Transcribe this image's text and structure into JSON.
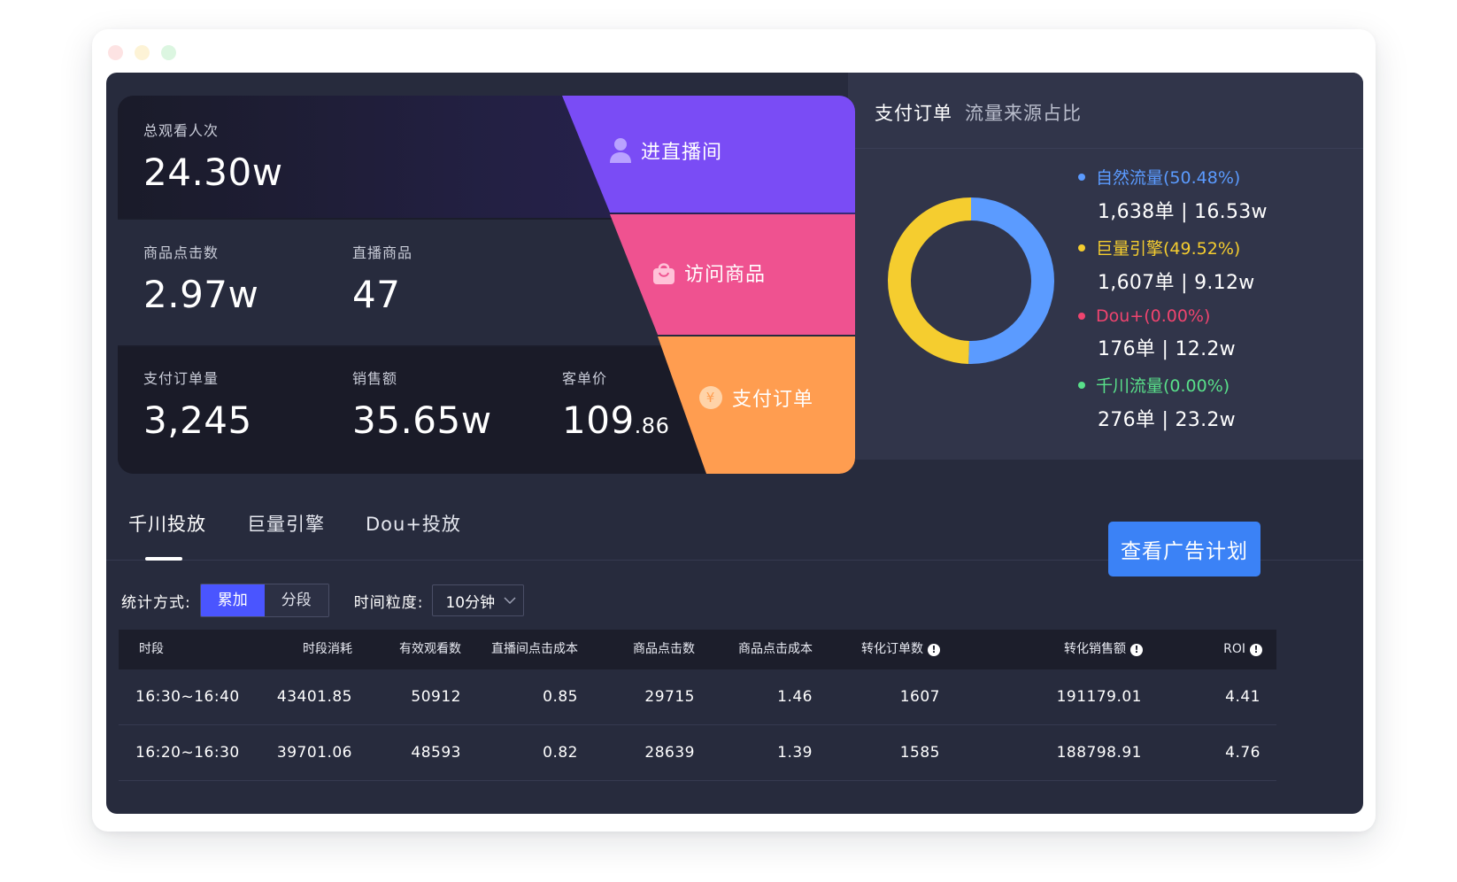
{
  "funnel": {
    "row1": {
      "total_viewers_label": "总观看人次",
      "total_viewers_value": "24.30w"
    },
    "row2": {
      "product_clicks_label": "商品点击数",
      "product_clicks_value": "2.97w",
      "live_products_label": "直播商品",
      "live_products_value": "47"
    },
    "row3": {
      "paid_orders_label": "支付订单量",
      "paid_orders_value": "3,245",
      "sales_label": "销售额",
      "sales_value": "35.65w",
      "unit_price_label": "客单价",
      "unit_price_int": "109",
      "unit_price_dec": ".86"
    },
    "segments": {
      "enter_live": "进直播间",
      "visit_products": "访问商品",
      "paid_orders": "支付订单"
    },
    "colors": {
      "purple": "#7a4cf5",
      "pink": "#ef5290",
      "orange": "#ff9d50"
    }
  },
  "traffic": {
    "title": "支付订单",
    "subtitle": "流量来源占比",
    "items": [
      {
        "name": "自然流量",
        "pct": "(50.48%)",
        "value": "1,638单 | 16.53w",
        "color": "#5b9bff"
      },
      {
        "name": "巨量引擎",
        "pct": "(49.52%)",
        "value": "1,607单 | 9.12w",
        "color": "#f5cd2f"
      },
      {
        "name": "Dou+",
        "pct": "(0.00%)",
        "value": "176单 | 12.2w",
        "color": "#f0446f"
      },
      {
        "name": "千川流量",
        "pct": "(0.00%)",
        "value": "276单 | 23.2w",
        "color": "#59e08a"
      }
    ],
    "donut": {
      "slices": [
        50.48,
        49.52,
        0,
        0
      ]
    }
  },
  "tabs": [
    {
      "label": "千川投放",
      "active": true
    },
    {
      "label": "巨量引擎",
      "active": false
    },
    {
      "label": "Dou+投放",
      "active": false
    }
  ],
  "ad_plan_button": "查看广告计划",
  "filters": {
    "stat_label": "统计方式:",
    "stat_options": [
      "累加",
      "分段"
    ],
    "stat_selected": "累加",
    "granularity_label": "时间粒度:",
    "granularity_value": "10分钟"
  },
  "table": {
    "headers": [
      "时段",
      "时段消耗",
      "有效观看数",
      "直播间点击成本",
      "商品点击数",
      "商品点击成本",
      "转化订单数",
      "转化销售额",
      "ROI"
    ],
    "rows": [
      [
        "16:30~16:40",
        "43401.85",
        "50912",
        "0.85",
        "29715",
        "1.46",
        "1607",
        "191179.01",
        "4.41"
      ],
      [
        "16:20~16:30",
        "39701.06",
        "48593",
        "0.82",
        "28639",
        "1.39",
        "1585",
        "188798.91",
        "4.76"
      ]
    ]
  }
}
